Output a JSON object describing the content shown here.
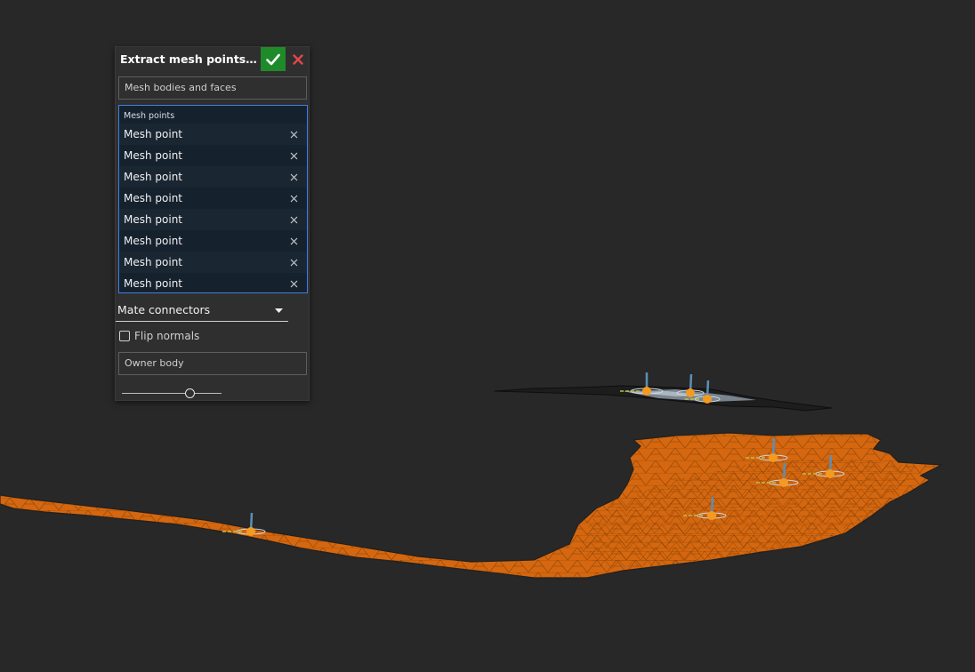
{
  "dialog": {
    "title": "Extract mesh points (normals)",
    "mesh_bodies_placeholder": "Mesh bodies and faces",
    "mesh_points_label": "Mesh points",
    "mesh_points": [
      "Mesh point",
      "Mesh point",
      "Mesh point",
      "Mesh point",
      "Mesh point",
      "Mesh point",
      "Mesh point",
      "Mesh point"
    ],
    "output_type": "Mate connectors",
    "flip_normals_label": "Flip normals",
    "flip_normals_checked": false,
    "owner_body_placeholder": "Owner body",
    "slider_value": 0.68
  },
  "icons": {
    "accept": "check-icon",
    "cancel": "close-icon",
    "remove": "close-x-icon",
    "dropdown": "caret-down-icon"
  },
  "colors": {
    "viewport_bg": "#282828",
    "mesh_fill": "#d4670f",
    "point_marker": "#f59a1f",
    "normal_line": "#5b8fb8",
    "accept_button": "#1f8a2a",
    "cancel_x": "#e0484a",
    "selection_border": "#3d7fe0"
  }
}
